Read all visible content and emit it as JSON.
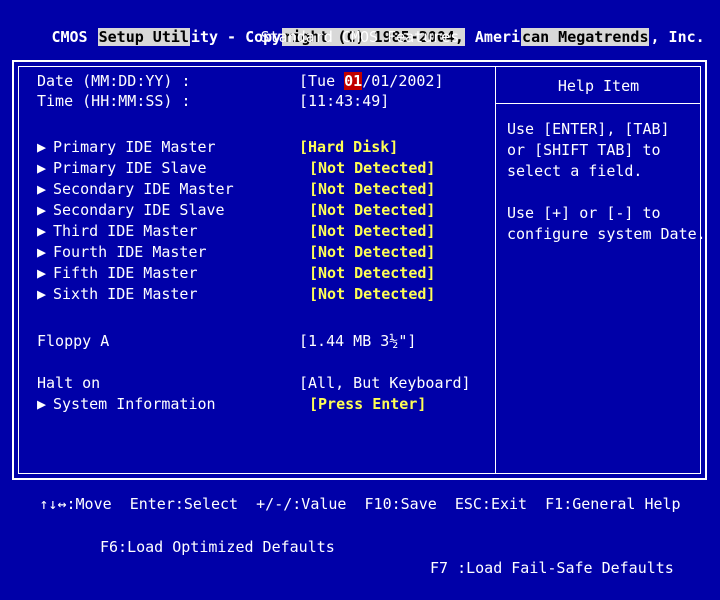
{
  "header": {
    "segments": [
      {
        "text": "CMOS ",
        "highlight": false
      },
      {
        "text": "Setup Util",
        "highlight": true
      },
      {
        "text": "ity - Copy",
        "highlight": false
      },
      {
        "text": "right (C) 1985-2004,",
        "highlight": true
      },
      {
        "text": " Ameri",
        "highlight": false
      },
      {
        "text": "can Megatrends",
        "highlight": true
      },
      {
        "text": ", Inc.",
        "highlight": false
      }
    ],
    "subtitle": "Standard CMOS Features"
  },
  "date": {
    "label": "Date (MM:DD:YY) :",
    "prefix": "[Tue ",
    "selected": "01",
    "suffix": "/01/2002]"
  },
  "time": {
    "label": "Time (HH:MM:SS) :",
    "value": "[11:43:49]"
  },
  "ide_items": [
    {
      "label": "Primary IDE Master",
      "value": "[Hard Disk]"
    },
    {
      "label": "Primary IDE Slave",
      "value": "[Not Detected]"
    },
    {
      "label": "Secondary IDE Master",
      "value": "[Not Detected]"
    },
    {
      "label": "Secondary IDE Slave",
      "value": "[Not Detected]"
    },
    {
      "label": "Third IDE Master",
      "value": "[Not Detected]"
    },
    {
      "label": "Fourth IDE Master",
      "value": "[Not Detected]"
    },
    {
      "label": "Fifth IDE Master",
      "value": "[Not Detected]"
    },
    {
      "label": "Sixth IDE Master",
      "value": "[Not Detected]"
    }
  ],
  "floppy": {
    "label": "Floppy A",
    "value": "[1.44 MB 3½\"]"
  },
  "halt": {
    "label": "Halt on",
    "value": "[All, But Keyboard]"
  },
  "sysinfo": {
    "label": "System Information",
    "value": "[Press Enter]"
  },
  "submenu_arrow": "▶",
  "help": {
    "title": "Help Item",
    "text": "Use [ENTER], [TAB]\nor [SHIFT TAB] to\nselect a field.\n\nUse [+] or [-] to\nconfigure system Date."
  },
  "footer": {
    "line1": "↑↓↔:Move  Enter:Select  +/-/:Value  F10:Save  ESC:Exit  F1:General Help",
    "line2_left": "F6:Load Optimized Defaults",
    "line2_right": "F7 :Load Fail-Safe Defaults"
  },
  "colors": {
    "background": "#0000a8",
    "value_yellow": "#ffff54",
    "selection_red": "#c00000",
    "header_highlight": "#d8d8d8"
  }
}
